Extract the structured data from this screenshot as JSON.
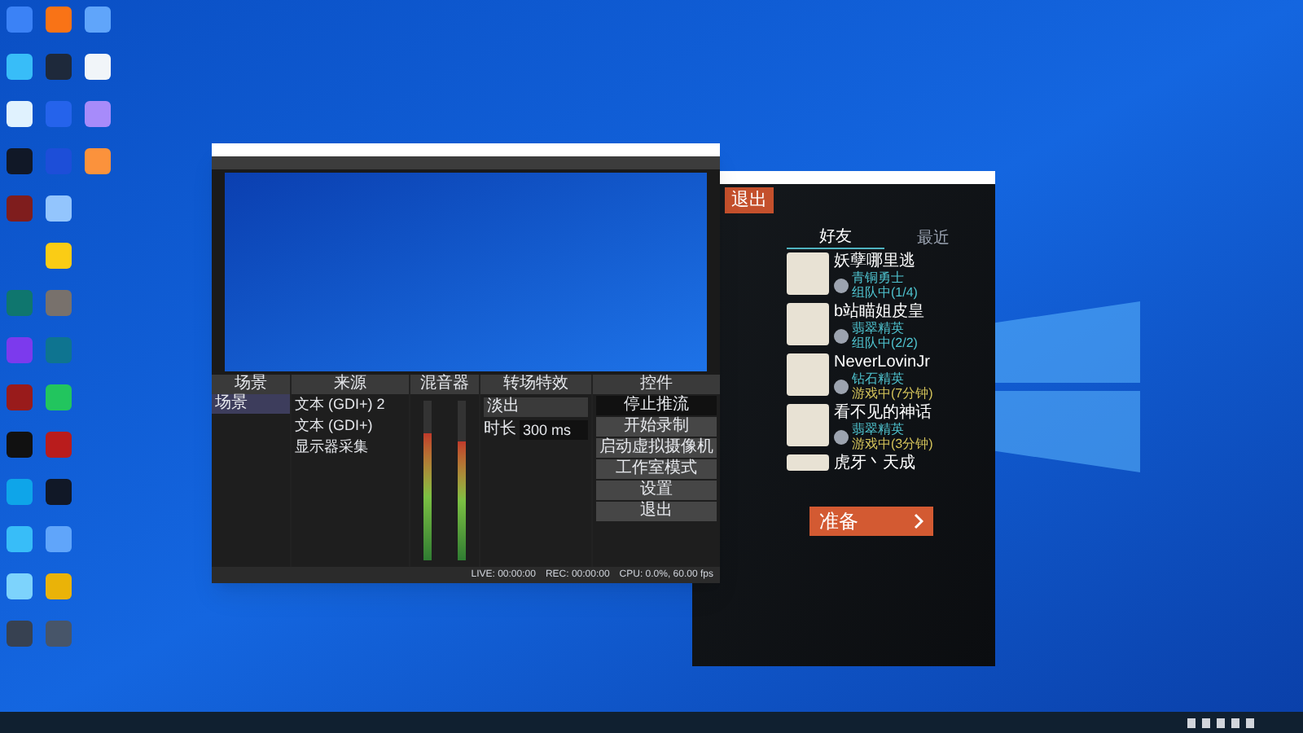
{
  "obs": {
    "docks": [
      {
        "title": "场景"
      },
      {
        "title": "来源"
      },
      {
        "title": "混音器"
      },
      {
        "title": "转场特效"
      },
      {
        "title": "控件"
      }
    ],
    "scenes": [
      {
        "label": "场景",
        "selected": true
      }
    ],
    "sources": [
      {
        "label": "文本 (GDI+) 2"
      },
      {
        "label": "文本 (GDI+)"
      },
      {
        "label": "显示器采集"
      }
    ],
    "mixer": [
      {
        "level": 0.8
      },
      {
        "level": 0.75
      }
    ],
    "transition": {
      "value": "淡出",
      "duration_label": "时长",
      "duration": "300 ms"
    },
    "controls": [
      {
        "label": "停止推流",
        "active": true
      },
      {
        "label": "开始录制",
        "active": false
      },
      {
        "label": "启动虚拟摄像机",
        "active": false
      },
      {
        "label": "工作室模式",
        "active": false
      },
      {
        "label": "设置",
        "active": false
      },
      {
        "label": "退出",
        "active": false
      }
    ],
    "status": [
      "LIVE: 00:00:00",
      "REC: 00:00:00",
      "CPU: 0.0%, 60.00 fps"
    ]
  },
  "game": {
    "exit": "退出",
    "tabs": [
      {
        "label": "好友",
        "selected": true
      },
      {
        "label": "最近",
        "selected": false
      }
    ],
    "friends": [
      {
        "name": "妖孽哪里逃",
        "rank": "青铜勇士",
        "status": "组队中(1/4)",
        "kind": "team"
      },
      {
        "name": "b站瞄姐皮皇",
        "rank": "翡翠精英",
        "status": "组队中(2/2)",
        "kind": "team"
      },
      {
        "name": "NeverLovinJr",
        "rank": "钻石精英",
        "status": "游戏中(7分钟)",
        "kind": "game"
      },
      {
        "name": "看不见的神话",
        "rank": "翡翠精英",
        "status": "游戏中(3分钟)",
        "kind": "game"
      },
      {
        "name": "虎牙丶天成"
      }
    ],
    "ready": "准备"
  }
}
